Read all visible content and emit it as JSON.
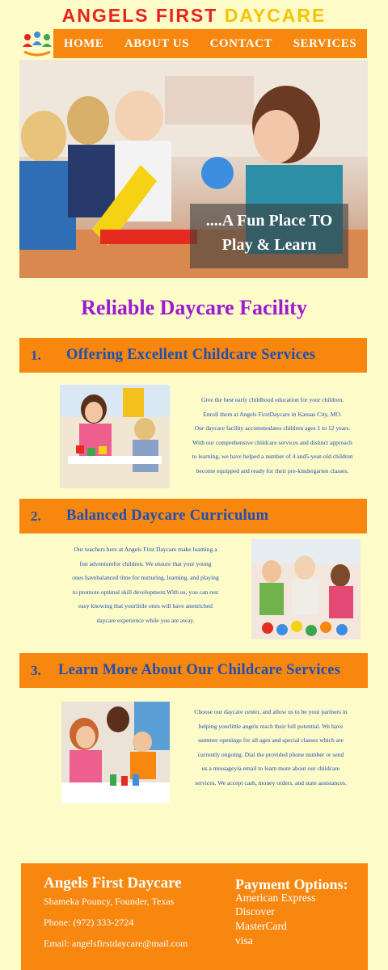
{
  "site": {
    "title_main": "ANGELS FIRST ",
    "title_accent": "DAYCARE"
  },
  "nav": {
    "items": [
      "HOME",
      "ABOUT US",
      "CONTACT",
      "SERVICES"
    ]
  },
  "hero": {
    "caption_line1": "....A Fun Place TO",
    "caption_line2": "Play & Learn"
  },
  "main": {
    "heading": "Reliable Daycare Facility"
  },
  "sections": [
    {
      "number": "1.",
      "title": "Offering Excellent Childcare Services",
      "lines": [
        "Give the best early childhood education for your children.",
        "Enroll them at Angels FirstDaycare in Kansas City, MO.",
        "Our daycare facility accommodates children ages 1 to 12 years.",
        "With our comprehensive childcare services and distinct approach",
        "to learning, we have helped a number of 4 and5-year-old children",
        "become equipped and ready for their pre-kindergarten classes."
      ]
    },
    {
      "number": "2.",
      "title": "Balanced Daycare Curriculum",
      "lines": [
        "Our teachers here at Angels First Daycare make learning a",
        "fun adventurefor children. We ensure that your young",
        "ones havebalanced time for nurturing, learning, and playing",
        "to promote optimal skill development.With us, you can rest",
        "easy knowing that yourlittle ones will have anenriched",
        "daycare experience while you are away."
      ]
    },
    {
      "number": "3.",
      "title": "Learn More About Our Childcare Services",
      "lines": [
        "Choose our daycare center, and allow us to be your partners in",
        "helping yourlittle angels reach their full potential. We have",
        "summer openings for all ages and special classes which are",
        "currently ongoing. Dial the provided phone number or send",
        "us a messageyia email to learn more about our childcare",
        "services. We accept cash, money orders, and state assistances."
      ]
    }
  ],
  "footer": {
    "name": "Angels First Daycare",
    "founder": "Shameka Pouncy, Founder, Texas",
    "phone": "Phone: (972) 333-2724",
    "email": "Email: angelsfirstdaycare@mail.com",
    "payment_title": "Payment Options:",
    "payment_methods": [
      "American Express",
      "Discover",
      "MasterCard",
      "visa"
    ]
  },
  "colors": {
    "background": "#fdfbc8",
    "accent_orange": "#f7870f",
    "heading_purple": "#9b1ad2",
    "text_blue": "#1c4fb6",
    "title_red": "#e8231f",
    "title_yellow": "#f5c400"
  },
  "icons": {
    "logo": "children-logo-icon"
  }
}
